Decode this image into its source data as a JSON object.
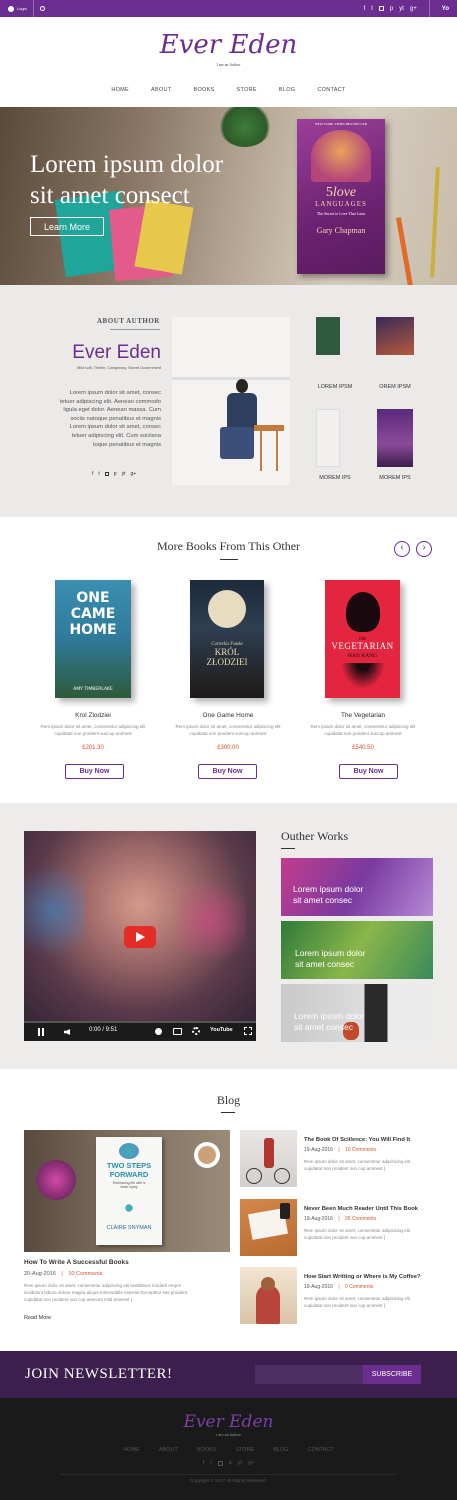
{
  "topbar": {
    "login": "Login",
    "social": [
      "f",
      "t",
      "ig",
      "p",
      "yt",
      "g+"
    ],
    "yahoo": "Yo"
  },
  "logo": {
    "name": "Ever Eden",
    "tagline": "I am an Author"
  },
  "nav": [
    "HOME",
    "ABOUT",
    "BOOKS",
    "STORE",
    "BLOG",
    "CONTACT"
  ],
  "hero": {
    "line1": "Lorem ipsum dolor",
    "line2": "sit amet consect",
    "button": "Learn More",
    "book": {
      "top": "NEW YORK TIMES BESTSELLER",
      "num": "5",
      "love": "love",
      "languages": "LANGUAGES",
      "sub": "The Secret to Love That Lasts",
      "author": "Gary Chapman"
    }
  },
  "about": {
    "heading": "ABOUT AUTHOR",
    "name": "Ever Eden",
    "genres": "Mild scifi, Thriller, Conspiracy, Secret Government",
    "bio": [
      "Lorem ipsum dolor sit amet, consec",
      "tetuer adipiscing elit. Aenean commodo",
      "ligula eget dolor. Aenean massa. Cum",
      "sociis natoque penatibus et magnis",
      "Lorem ipsum dolor sit amet, consec",
      "tetuer adipiscing elit. Cum sociisna",
      "toque penatibus et magnis"
    ],
    "books": [
      "LOREM IPSM",
      "OREM IPSM",
      "MOREM IPS",
      "MOREM IPS"
    ]
  },
  "books": {
    "title": "More Books From This Other",
    "items": [
      {
        "title": "Krol Zlodziei",
        "desc1": "Rem ipsum dolor sit amet, consectetur adipiscing elit",
        "desc2": "cupidatat non proident suncup animest",
        "price": "£201.30",
        "button": "Buy Now",
        "cover": {
          "c1": "ONE",
          "c2": "CAME",
          "c3": "HOME",
          "author": "AMY TIMBERLAKE"
        }
      },
      {
        "title": "One Game Home",
        "desc1": "Rem ipsum dolor sit amet, consectetur adipiscing elit",
        "desc2": "cupidatat non proident suncup animest",
        "price": "£300.00",
        "button": "Buy Now",
        "cover": {
          "author": "Cornelia Funke",
          "c1": "KRÓL",
          "c2": "ZŁODZIEI"
        }
      },
      {
        "title": "The Vegetarian",
        "desc1": "Rem ipsum dolor sit amet, consectetur adipiscing elit",
        "desc2": "cupidatat non proident suncup animest",
        "price": "£540.50",
        "button": "Buy Now",
        "cover": {
          "the": "THE",
          "c1": "VEGETARIAN",
          "author": "HAN KANG"
        }
      }
    ]
  },
  "video": {
    "time": "0:00 / 9:51",
    "brand": "YouTube"
  },
  "works": {
    "title": "Outher Works",
    "items": [
      {
        "l1": "Lorem ipsum dolor",
        "l2": "sit amet consec"
      },
      {
        "l1": "Lorem ipsum dolor",
        "l2": "sit amet consec"
      },
      {
        "l1": "Lorem ipsum dolor",
        "l2": "sit amet consec"
      }
    ]
  },
  "blog": {
    "title": "Blog",
    "featured": {
      "title": "How To Write A Successful Books",
      "date": "20-Aug-2016",
      "comments": "10 Comments",
      "text1": "Rem ipsum dolor sit amet, consectetur adipiscing elit sedddeius modarti empor",
      "text2": "incididunt labore dolore magna aliqua minmsdalla varisme Excepteur sint proident",
      "text3": "cupidatat non proident sun cup asenunt mild animest ]",
      "more": "Read More",
      "book": {
        "l1": "TWO STEPS",
        "l2": "FORWARD",
        "sub1": "Embracing life with a",
        "sub2": "brain injury",
        "author": "CLAIRE SNYMAN"
      }
    },
    "posts": [
      {
        "title": "The Book Of Sciilence: You Will Find It",
        "date": "19-Aug-2016",
        "comments": "10 Comments",
        "t1": "Rem ipsum dolor sit amet, consectetur adipisicing elit",
        "t2": "cupidatat non proident sun cup animest ]"
      },
      {
        "title": "Never Been Much Reader Until This Book",
        "date": "19-Aug-2016",
        "comments": "05 Comments",
        "t1": "Rem ipsum dolor sit amet, consectetur adipisicing elit",
        "t2": "cupidatat non proident sun cup animest ]"
      },
      {
        "title": "How Start Writting or Where is My Coffee?",
        "date": "19-Aug-2016",
        "comments": "0 Comments",
        "t1": "Rem ipsum dolor sit amet, consectetur adipisicing elit",
        "t2": "cupidatat non proident sun cup animest ]"
      }
    ],
    "sep": "|"
  },
  "newsletter": {
    "title": "JOIN NEWSLETTER!",
    "button": "SUBSCRIBE",
    "placeholder": ""
  },
  "footer": {
    "name": "Ever Eden",
    "tagline": "I am an Author",
    "nav": [
      "HOME",
      "ABOUT",
      "BOOKS",
      "STORE",
      "BLOG",
      "CONTACT"
    ],
    "copyright": "Copyright © 2017 All Rights Reserved."
  },
  "colors": {
    "accent": "#6b2d8f",
    "price": "#d9532c",
    "dark": "#3c1f4e"
  }
}
